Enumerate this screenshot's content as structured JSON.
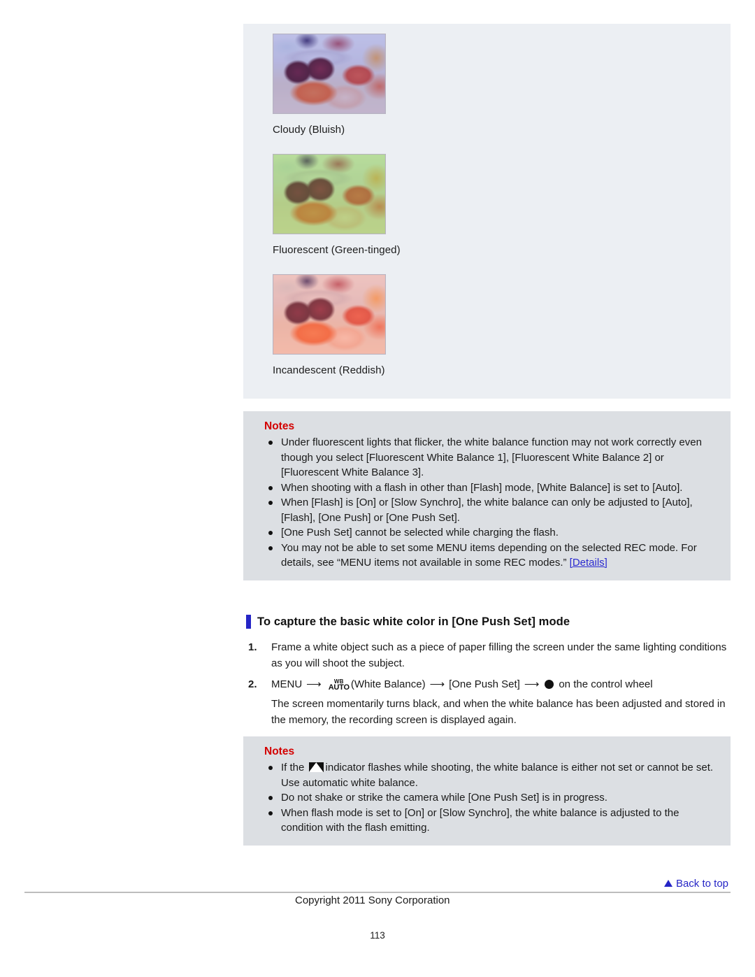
{
  "samples": [
    {
      "caption": "Cloudy (Bluish)",
      "tint": "cloudy"
    },
    {
      "caption": "Fluorescent (Green-tinged)",
      "tint": "fluorescent"
    },
    {
      "caption": "Incandescent (Reddish)",
      "tint": "incandescent"
    }
  ],
  "notes_first": {
    "title": "Notes",
    "items": [
      "Under fluorescent lights that flicker, the white balance function may not work correctly even though you select [Fluorescent White Balance 1], [Fluorescent White Balance 2] or [Fluorescent White Balance 3].",
      "When shooting with a flash in other than [Flash] mode, [White Balance] is set to [Auto].",
      "When [Flash] is [On] or [Slow Synchro], the white balance can only be adjusted to [Auto], [Flash], [One Push] or [One Push Set].",
      "[One Push Set] cannot be selected while charging the flash.",
      "You may not be able to set some MENU items depending on the selected REC mode. For details, see “MENU items not available in some REC modes.” "
    ],
    "details_link": "[Details]"
  },
  "section": {
    "heading": "To capture the basic white color in [One Push Set] mode",
    "accent_color": "#2525c6"
  },
  "steps": [
    {
      "number": "1.",
      "text": "Frame a white object such as a piece of paper filling the screen under the same lighting conditions as you will shoot the subject."
    },
    {
      "number": "2.",
      "menu_label": "MENU",
      "wb_icon_top": "WB",
      "wb_icon_bottom": "AUTO",
      "wb_label": "(White Balance)",
      "option_label": "[One Push Set]",
      "wheel_label": "on the control wheel",
      "detail": "The screen momentarily turns black, and when the white balance has been adjusted and stored in the memory, the recording screen is displayed again."
    }
  ],
  "notes_second": {
    "title": "Notes",
    "item_1_prefix": "If the ",
    "item_1_suffix": "indicator flashes while shooting, the white balance is either not set or cannot be set. Use automatic white balance.",
    "items_rest": [
      "Do not shake or strike the camera while [One Push Set] is in progress.",
      "When flash mode is set to [On] or [Slow Synchro], the white balance is adjusted to the condition with the flash emitting."
    ]
  },
  "footer": {
    "back_to_top": "Back to top",
    "copyright": "Copyright 2011 Sony Corporation",
    "page_number": "113"
  }
}
